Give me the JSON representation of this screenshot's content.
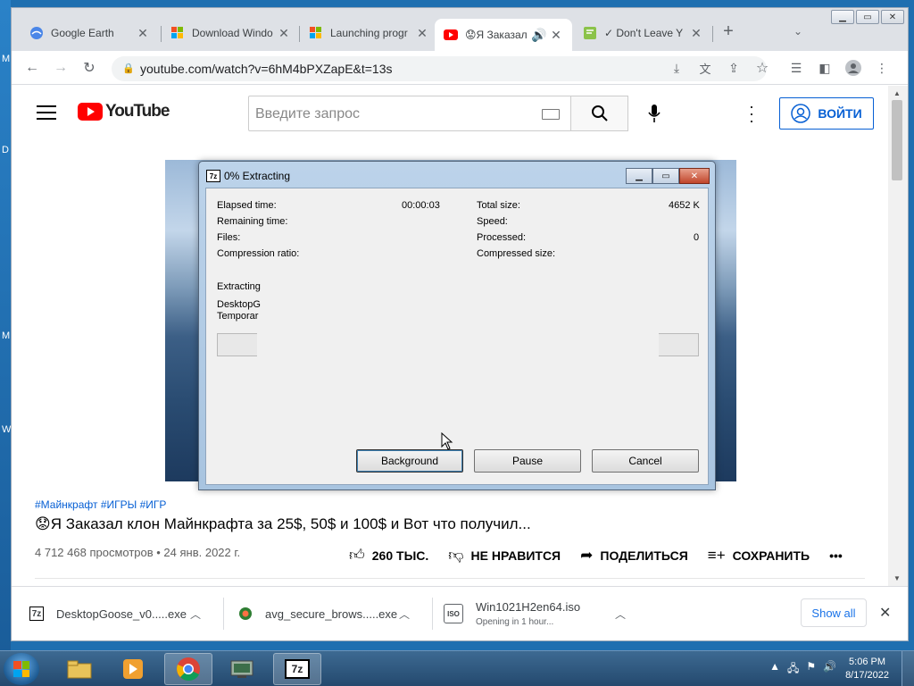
{
  "desktop": {
    "side_labels": [
      "M",
      "D",
      "M",
      "W"
    ]
  },
  "tabs": [
    {
      "title": "Google Earth",
      "favicon": "google-earth-icon",
      "active": false
    },
    {
      "title": "Download Windo",
      "favicon": "microsoft-icon",
      "active": false
    },
    {
      "title": "Launching progr",
      "favicon": "microsoft-icon",
      "active": false
    },
    {
      "title": "😟Я Заказал",
      "favicon": "youtube-icon",
      "active": true,
      "audio": "🔊"
    },
    {
      "title": "✓ Don't Leave Y",
      "favicon": "green-note-icon",
      "active": false
    }
  ],
  "new_tab": "+",
  "omnibox": {
    "url": "youtube.com/watch?v=6hM4bPXZapE&t=13s"
  },
  "youtube": {
    "logo_text": "YouTube",
    "search_placeholder": "Введите запрос",
    "login_label": "ВОЙТИ",
    "video": {
      "tags": "#Майнкрафт #ИГРЫ #ИГР",
      "title": "😟Я Заказал клон Майнкрафта за 25$, 50$ и 100$ и Вот что получил...",
      "views": "4 712 468 просмотров • 24 янв. 2022 г.",
      "likes": "260 ТЫС.",
      "dislike": "НЕ НРАВИТСЯ",
      "share": "ПОДЕЛИТЬСЯ",
      "save": "СОХРАНИТЬ",
      "more": "•••"
    }
  },
  "dialog": {
    "title": "0% Extracting",
    "elapsed_label": "Elapsed time:",
    "elapsed_value": "00:00:03",
    "remaining_label": "Remaining time:",
    "files_label": "Files:",
    "compression_label": "Compression ratio:",
    "total_label": "Total size:",
    "total_value": "4652 K",
    "speed_label": "Speed:",
    "processed_label": "Processed:",
    "processed_value": "0",
    "compressed_label": "Compressed size:",
    "op_label": "Extracting",
    "file_line1": "DesktopG",
    "file_line2": "Temporar",
    "progress": 0,
    "btn_background": "Background",
    "btn_pause": "Pause",
    "btn_cancel": "Cancel"
  },
  "downloads": [
    {
      "name": "DesktopGoose_v0.....exe",
      "icon": "7z-icon",
      "sub": ""
    },
    {
      "name": "avg_secure_brows.....exe",
      "icon": "avg-icon",
      "sub": ""
    },
    {
      "name": "Win1021H2en64.iso",
      "icon": "iso-icon",
      "sub": "Opening in 1 hour..."
    }
  ],
  "show_all": "Show all",
  "taskbar": {
    "time": "5:06 PM",
    "date": "8/17/2022"
  }
}
